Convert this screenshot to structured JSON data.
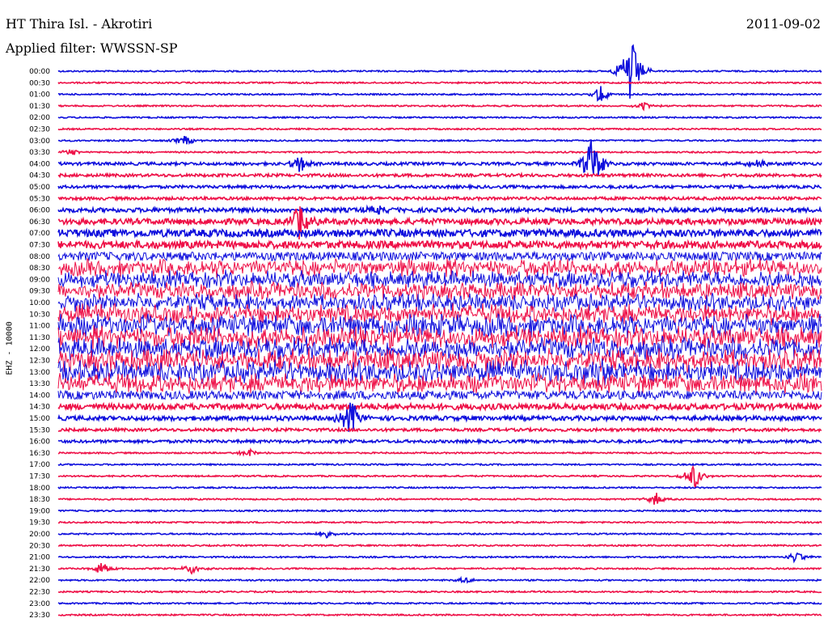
{
  "header": {
    "station": "HT Thira Isl. - Akrotiri",
    "filter": "Applied filter: WWSSN-SP",
    "date": "2011-09-02"
  },
  "colors": {
    "trace_a": "#1010dd",
    "trace_b": "#ee1148"
  },
  "chart_data": {
    "type": "line",
    "title": "HT Thira Isl. - Akrotiri",
    "subtitle": "Applied filter: WWSSN-SP",
    "date": "2011-09-02",
    "ylabel": "EHZ - 10000",
    "xlabel": "",
    "grid": false,
    "rows": [
      "00:00",
      "00:30",
      "01:00",
      "01:30",
      "02:00",
      "02:30",
      "03:00",
      "03:30",
      "04:00",
      "04:30",
      "05:00",
      "05:30",
      "06:00",
      "06:30",
      "07:00",
      "07:30",
      "08:00",
      "08:30",
      "09:00",
      "09:30",
      "10:00",
      "10:30",
      "11:00",
      "11:30",
      "12:00",
      "12:30",
      "13:00",
      "13:30",
      "14:00",
      "14:30",
      "15:00",
      "15:30",
      "16:00",
      "16:30",
      "17:00",
      "17:30",
      "18:00",
      "18:30",
      "19:00",
      "19:30",
      "20:00",
      "20:30",
      "21:00",
      "21:30",
      "22:00",
      "22:30",
      "23:00",
      "23:30"
    ],
    "noise_level": [
      1,
      1,
      1,
      1,
      1,
      1,
      1,
      1,
      2,
      2,
      2,
      2,
      3,
      4,
      5,
      5,
      6,
      7,
      7,
      7,
      7,
      8,
      9,
      9,
      9,
      9,
      9,
      8,
      6,
      4,
      3,
      2,
      2,
      1,
      1,
      1,
      1,
      1,
      1,
      1,
      1,
      1,
      1,
      1,
      1,
      1,
      1,
      1
    ],
    "events": [
      {
        "row": "00:00",
        "minute": 22.5,
        "amplitude": 50
      },
      {
        "row": "01:00",
        "minute": 21.3,
        "amplitude": 12
      },
      {
        "row": "01:30",
        "minute": 23.0,
        "amplitude": 6
      },
      {
        "row": "03:00",
        "minute": 5.0,
        "amplitude": 8
      },
      {
        "row": "03:30",
        "minute": 0.5,
        "amplitude": 5
      },
      {
        "row": "04:00",
        "minute": 27.5,
        "amplitude": 6
      },
      {
        "row": "04:00",
        "minute": 21.0,
        "amplitude": 40
      },
      {
        "row": "04:00",
        "minute": 9.5,
        "amplitude": 12
      },
      {
        "row": "06:00",
        "minute": 12.5,
        "amplitude": 6
      },
      {
        "row": "06:30",
        "minute": 9.5,
        "amplitude": 25
      },
      {
        "row": "13:00",
        "minute": 21.5,
        "amplitude": 20
      },
      {
        "row": "15:00",
        "minute": 11.5,
        "amplitude": 25
      },
      {
        "row": "16:30",
        "minute": 7.5,
        "amplitude": 6
      },
      {
        "row": "17:30",
        "minute": 25.0,
        "amplitude": 18
      },
      {
        "row": "18:30",
        "minute": 23.5,
        "amplitude": 8
      },
      {
        "row": "20:00",
        "minute": 10.5,
        "amplitude": 5
      },
      {
        "row": "21:00",
        "minute": 29.0,
        "amplitude": 8
      },
      {
        "row": "21:30",
        "minute": 1.7,
        "amplitude": 10
      },
      {
        "row": "21:30",
        "minute": 5.3,
        "amplitude": 8
      },
      {
        "row": "22:00",
        "minute": 16.0,
        "amplitude": 4
      }
    ]
  }
}
